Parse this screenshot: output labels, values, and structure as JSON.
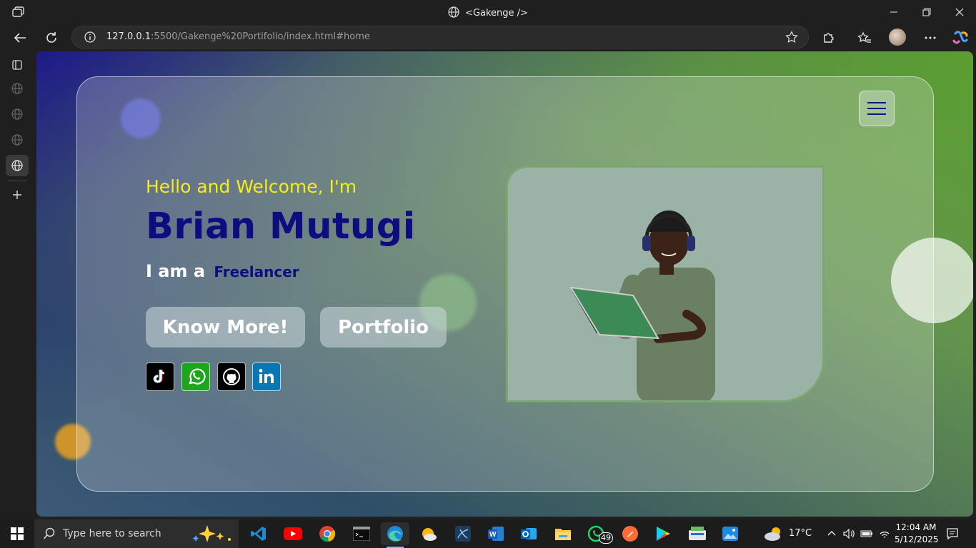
{
  "browser": {
    "tab_title": "<Gakenge />",
    "url_host": "127.0.0.1",
    "url_rest": ":5500/Gakenge%20Portifolio/index.html#home"
  },
  "hero": {
    "greeting": "Hello and Welcome, I'm",
    "name": "Brian Mutugi",
    "iam_prefix": "I am a",
    "role": "Freelancer",
    "btn_know_more": "Know More!",
    "btn_portfolio": "Portfolio"
  },
  "social": [
    "tiktok-icon",
    "whatsapp-icon",
    "github-icon",
    "linkedin-icon"
  ],
  "colors": {
    "greeting": "#f5ee16",
    "name": "#0e0c7e",
    "whatsapp": "#1ca61c",
    "linkedin": "#0a77b5"
  },
  "taskbar": {
    "search_placeholder": "Type here to search",
    "temperature": "17°C",
    "time": "12:04 AM",
    "date": "5/12/2025",
    "whatsapp_badge": "49"
  }
}
